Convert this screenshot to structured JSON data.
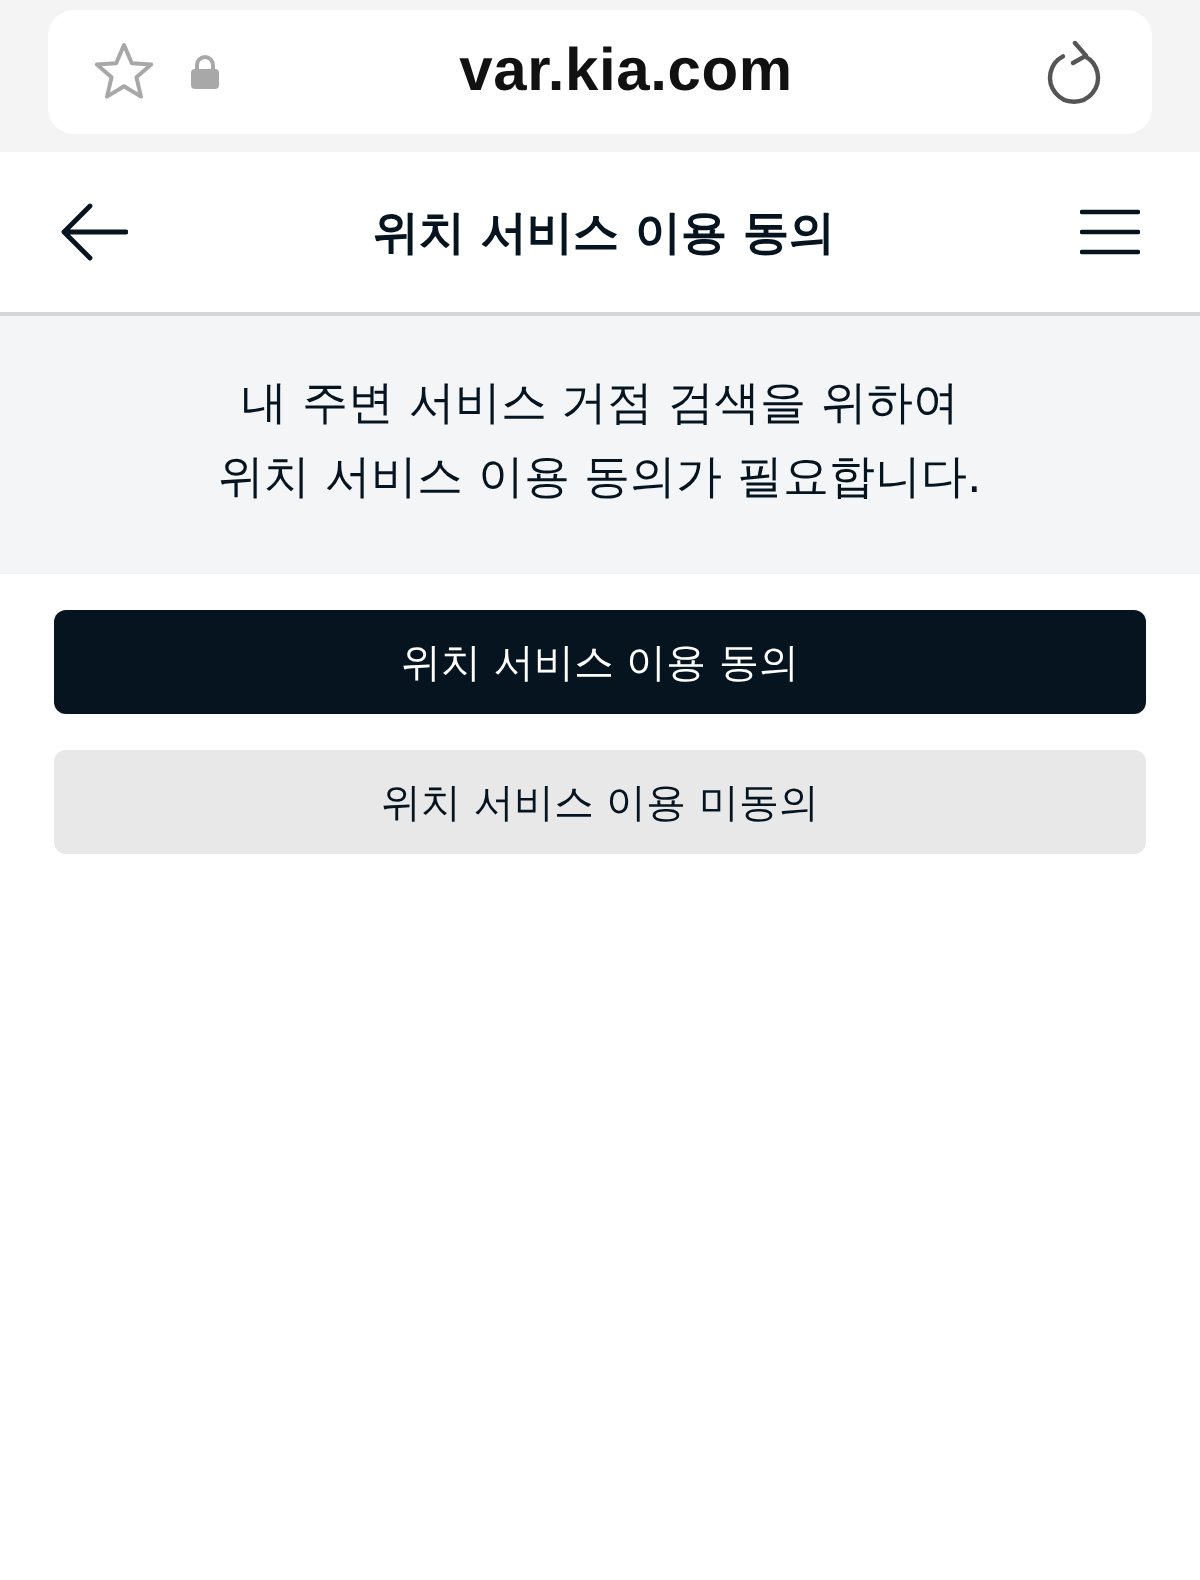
{
  "browser_bar": {
    "url": "var.kia.com"
  },
  "header": {
    "title": "위치 서비스 이용 동의"
  },
  "notice": {
    "lines": [
      "내 주변 서비스 거점 검색을 위하여",
      "위치 서비스 이용 동의가 필요합니다."
    ]
  },
  "buttons": [
    {
      "label": "위치 서비스 이용 동의",
      "kind": "primary"
    },
    {
      "label": "위치 서비스 이용 미동의",
      "kind": "secondary"
    }
  ]
}
